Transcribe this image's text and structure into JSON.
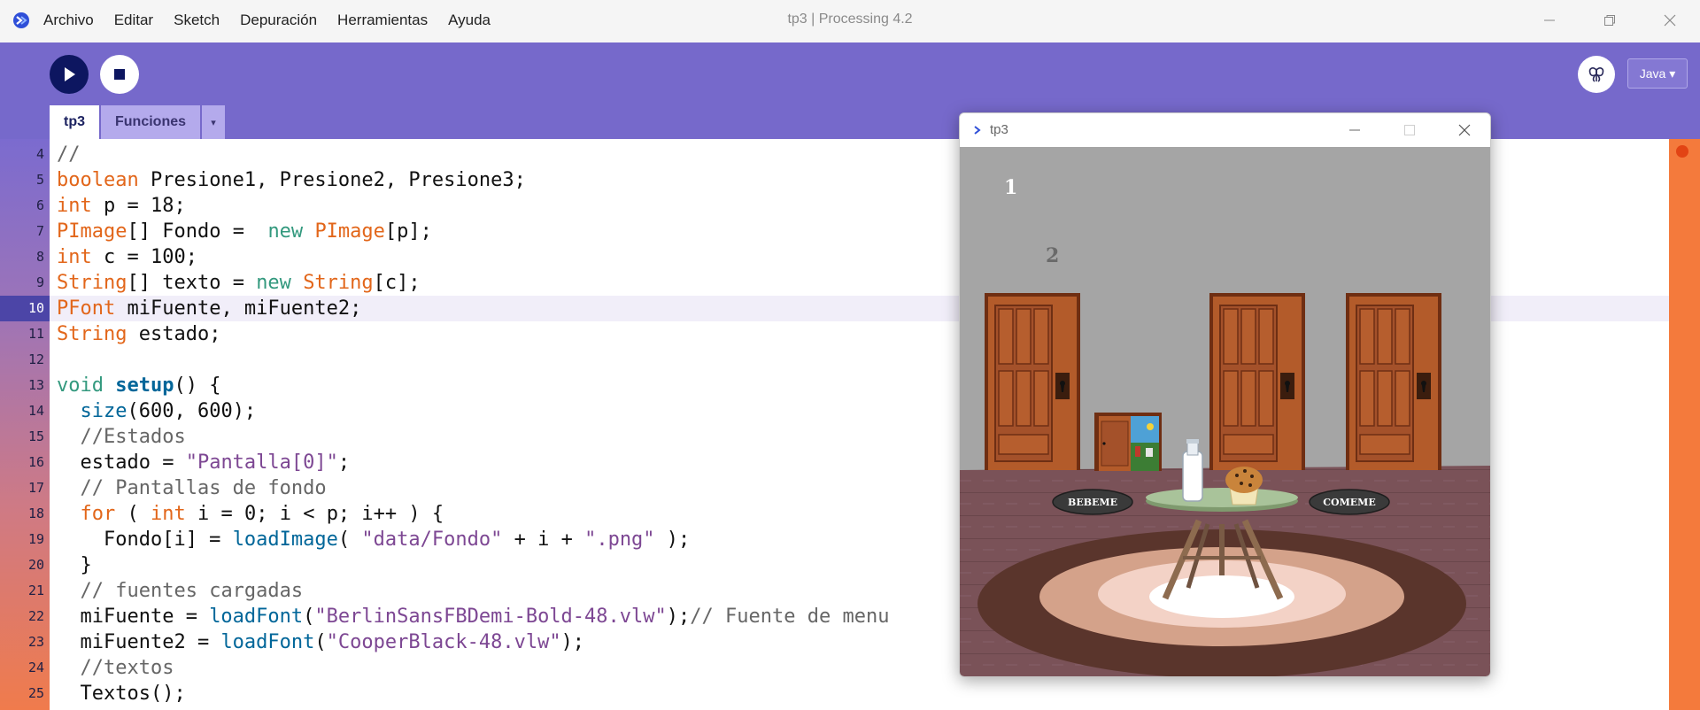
{
  "app": {
    "window_title": "tp3 | Processing 4.2",
    "menus": [
      "Archivo",
      "Editar",
      "Sketch",
      "Depuración",
      "Herramientas",
      "Ayuda"
    ]
  },
  "toolbar": {
    "mode_label": "Java ▾",
    "tabs": [
      "tp3",
      "Funciones"
    ],
    "tab_menu_label": "▾"
  },
  "editor": {
    "current_line": 10,
    "lines": [
      {
        "n": "4",
        "html": "<span class=\"k-cm\">//</span>"
      },
      {
        "n": "5",
        "html": "<span class=\"k-type\">boolean</span> Presione1, Presione2, Presione3;"
      },
      {
        "n": "6",
        "html": "<span class=\"k-type\">int</span> p = 18;"
      },
      {
        "n": "7",
        "html": "<span class=\"k-type\">PImage</span>[] Fondo =  <span class=\"k-kw\">new</span> <span class=\"k-type\">PImage</span>[p];"
      },
      {
        "n": "8",
        "html": "<span class=\"k-type\">int</span> c = 100;"
      },
      {
        "n": "9",
        "html": "<span class=\"k-type\">String</span>[] texto = <span class=\"k-kw\">new</span> <span class=\"k-type\">String</span>[c];"
      },
      {
        "n": "10",
        "html": "<span class=\"k-type\">PFont</span> miFuente, miFuente2;"
      },
      {
        "n": "11",
        "html": "<span class=\"k-type\">String</span> estado;"
      },
      {
        "n": "12",
        "html": ""
      },
      {
        "n": "13",
        "html": "<span class=\"k-kw\">void</span> <span class=\"k-fnb\">setup</span>() {"
      },
      {
        "n": "14",
        "html": "  <span class=\"k-fn\">size</span>(600, 600);"
      },
      {
        "n": "15",
        "html": "  <span class=\"k-cm\">//Estados</span>"
      },
      {
        "n": "16",
        "html": "  estado = <span class=\"k-str\">\"Pantalla[0]\"</span>;"
      },
      {
        "n": "17",
        "html": "  <span class=\"k-cm\">// Pantallas de fondo</span>"
      },
      {
        "n": "18",
        "html": "  <span class=\"k-type\">for</span> ( <span class=\"k-type\">int</span> i = 0; i &lt; p; i++ ) {"
      },
      {
        "n": "19",
        "html": "    Fondo[i] = <span class=\"k-fn\">loadImage</span>( <span class=\"k-str\">\"data/Fondo\"</span> + i + <span class=\"k-str\">\".png\"</span> );"
      },
      {
        "n": "20",
        "html": "  }"
      },
      {
        "n": "21",
        "html": "  <span class=\"k-cm\">// fuentes cargadas</span>"
      },
      {
        "n": "22",
        "html": "  miFuente = <span class=\"k-fn\">loadFont</span>(<span class=\"k-str\">\"BerlinSansFBDemi-Bold-48.vlw\"</span>);<span class=\"k-cm\">// Fuente de menu</span>"
      },
      {
        "n": "23",
        "html": "  miFuente2 = <span class=\"k-fn\">loadFont</span>(<span class=\"k-str\">\"CooperBlack-48.vlw\"</span>);"
      },
      {
        "n": "24",
        "html": "  <span class=\"k-cm\">//textos</span>"
      },
      {
        "n": "25",
        "html": "  Textos();"
      },
      {
        "n": "",
        "html": "}"
      }
    ]
  },
  "sketch": {
    "title": "tp3",
    "number_1": "1",
    "number_2": "2",
    "bebeme_label": "BEBEME",
    "comeme_label": "COMEME"
  }
}
